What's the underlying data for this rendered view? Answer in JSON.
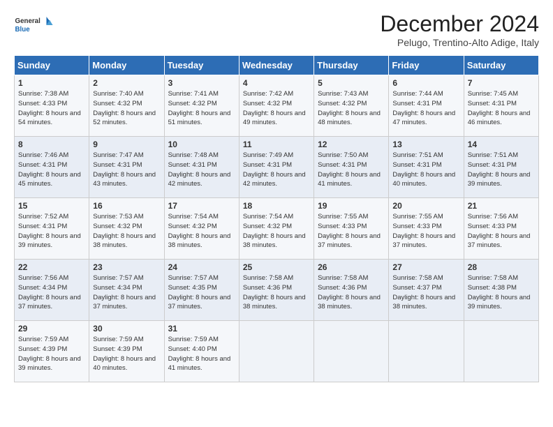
{
  "header": {
    "logo_line1": "General",
    "logo_line2": "Blue",
    "title": "December 2024",
    "subtitle": "Pelugo, Trentino-Alto Adige, Italy"
  },
  "days_of_week": [
    "Sunday",
    "Monday",
    "Tuesday",
    "Wednesday",
    "Thursday",
    "Friday",
    "Saturday"
  ],
  "weeks": [
    [
      {
        "day": "1",
        "sunrise": "Sunrise: 7:38 AM",
        "sunset": "Sunset: 4:33 PM",
        "daylight": "Daylight: 8 hours and 54 minutes."
      },
      {
        "day": "2",
        "sunrise": "Sunrise: 7:40 AM",
        "sunset": "Sunset: 4:32 PM",
        "daylight": "Daylight: 8 hours and 52 minutes."
      },
      {
        "day": "3",
        "sunrise": "Sunrise: 7:41 AM",
        "sunset": "Sunset: 4:32 PM",
        "daylight": "Daylight: 8 hours and 51 minutes."
      },
      {
        "day": "4",
        "sunrise": "Sunrise: 7:42 AM",
        "sunset": "Sunset: 4:32 PM",
        "daylight": "Daylight: 8 hours and 49 minutes."
      },
      {
        "day": "5",
        "sunrise": "Sunrise: 7:43 AM",
        "sunset": "Sunset: 4:32 PM",
        "daylight": "Daylight: 8 hours and 48 minutes."
      },
      {
        "day": "6",
        "sunrise": "Sunrise: 7:44 AM",
        "sunset": "Sunset: 4:31 PM",
        "daylight": "Daylight: 8 hours and 47 minutes."
      },
      {
        "day": "7",
        "sunrise": "Sunrise: 7:45 AM",
        "sunset": "Sunset: 4:31 PM",
        "daylight": "Daylight: 8 hours and 46 minutes."
      }
    ],
    [
      {
        "day": "8",
        "sunrise": "Sunrise: 7:46 AM",
        "sunset": "Sunset: 4:31 PM",
        "daylight": "Daylight: 8 hours and 45 minutes."
      },
      {
        "day": "9",
        "sunrise": "Sunrise: 7:47 AM",
        "sunset": "Sunset: 4:31 PM",
        "daylight": "Daylight: 8 hours and 43 minutes."
      },
      {
        "day": "10",
        "sunrise": "Sunrise: 7:48 AM",
        "sunset": "Sunset: 4:31 PM",
        "daylight": "Daylight: 8 hours and 42 minutes."
      },
      {
        "day": "11",
        "sunrise": "Sunrise: 7:49 AM",
        "sunset": "Sunset: 4:31 PM",
        "daylight": "Daylight: 8 hours and 42 minutes."
      },
      {
        "day": "12",
        "sunrise": "Sunrise: 7:50 AM",
        "sunset": "Sunset: 4:31 PM",
        "daylight": "Daylight: 8 hours and 41 minutes."
      },
      {
        "day": "13",
        "sunrise": "Sunrise: 7:51 AM",
        "sunset": "Sunset: 4:31 PM",
        "daylight": "Daylight: 8 hours and 40 minutes."
      },
      {
        "day": "14",
        "sunrise": "Sunrise: 7:51 AM",
        "sunset": "Sunset: 4:31 PM",
        "daylight": "Daylight: 8 hours and 39 minutes."
      }
    ],
    [
      {
        "day": "15",
        "sunrise": "Sunrise: 7:52 AM",
        "sunset": "Sunset: 4:31 PM",
        "daylight": "Daylight: 8 hours and 39 minutes."
      },
      {
        "day": "16",
        "sunrise": "Sunrise: 7:53 AM",
        "sunset": "Sunset: 4:32 PM",
        "daylight": "Daylight: 8 hours and 38 minutes."
      },
      {
        "day": "17",
        "sunrise": "Sunrise: 7:54 AM",
        "sunset": "Sunset: 4:32 PM",
        "daylight": "Daylight: 8 hours and 38 minutes."
      },
      {
        "day": "18",
        "sunrise": "Sunrise: 7:54 AM",
        "sunset": "Sunset: 4:32 PM",
        "daylight": "Daylight: 8 hours and 38 minutes."
      },
      {
        "day": "19",
        "sunrise": "Sunrise: 7:55 AM",
        "sunset": "Sunset: 4:33 PM",
        "daylight": "Daylight: 8 hours and 37 minutes."
      },
      {
        "day": "20",
        "sunrise": "Sunrise: 7:55 AM",
        "sunset": "Sunset: 4:33 PM",
        "daylight": "Daylight: 8 hours and 37 minutes."
      },
      {
        "day": "21",
        "sunrise": "Sunrise: 7:56 AM",
        "sunset": "Sunset: 4:33 PM",
        "daylight": "Daylight: 8 hours and 37 minutes."
      }
    ],
    [
      {
        "day": "22",
        "sunrise": "Sunrise: 7:56 AM",
        "sunset": "Sunset: 4:34 PM",
        "daylight": "Daylight: 8 hours and 37 minutes."
      },
      {
        "day": "23",
        "sunrise": "Sunrise: 7:57 AM",
        "sunset": "Sunset: 4:34 PM",
        "daylight": "Daylight: 8 hours and 37 minutes."
      },
      {
        "day": "24",
        "sunrise": "Sunrise: 7:57 AM",
        "sunset": "Sunset: 4:35 PM",
        "daylight": "Daylight: 8 hours and 37 minutes."
      },
      {
        "day": "25",
        "sunrise": "Sunrise: 7:58 AM",
        "sunset": "Sunset: 4:36 PM",
        "daylight": "Daylight: 8 hours and 38 minutes."
      },
      {
        "day": "26",
        "sunrise": "Sunrise: 7:58 AM",
        "sunset": "Sunset: 4:36 PM",
        "daylight": "Daylight: 8 hours and 38 minutes."
      },
      {
        "day": "27",
        "sunrise": "Sunrise: 7:58 AM",
        "sunset": "Sunset: 4:37 PM",
        "daylight": "Daylight: 8 hours and 38 minutes."
      },
      {
        "day": "28",
        "sunrise": "Sunrise: 7:58 AM",
        "sunset": "Sunset: 4:38 PM",
        "daylight": "Daylight: 8 hours and 39 minutes."
      }
    ],
    [
      {
        "day": "29",
        "sunrise": "Sunrise: 7:59 AM",
        "sunset": "Sunset: 4:39 PM",
        "daylight": "Daylight: 8 hours and 39 minutes."
      },
      {
        "day": "30",
        "sunrise": "Sunrise: 7:59 AM",
        "sunset": "Sunset: 4:39 PM",
        "daylight": "Daylight: 8 hours and 40 minutes."
      },
      {
        "day": "31",
        "sunrise": "Sunrise: 7:59 AM",
        "sunset": "Sunset: 4:40 PM",
        "daylight": "Daylight: 8 hours and 41 minutes."
      },
      null,
      null,
      null,
      null
    ]
  ]
}
